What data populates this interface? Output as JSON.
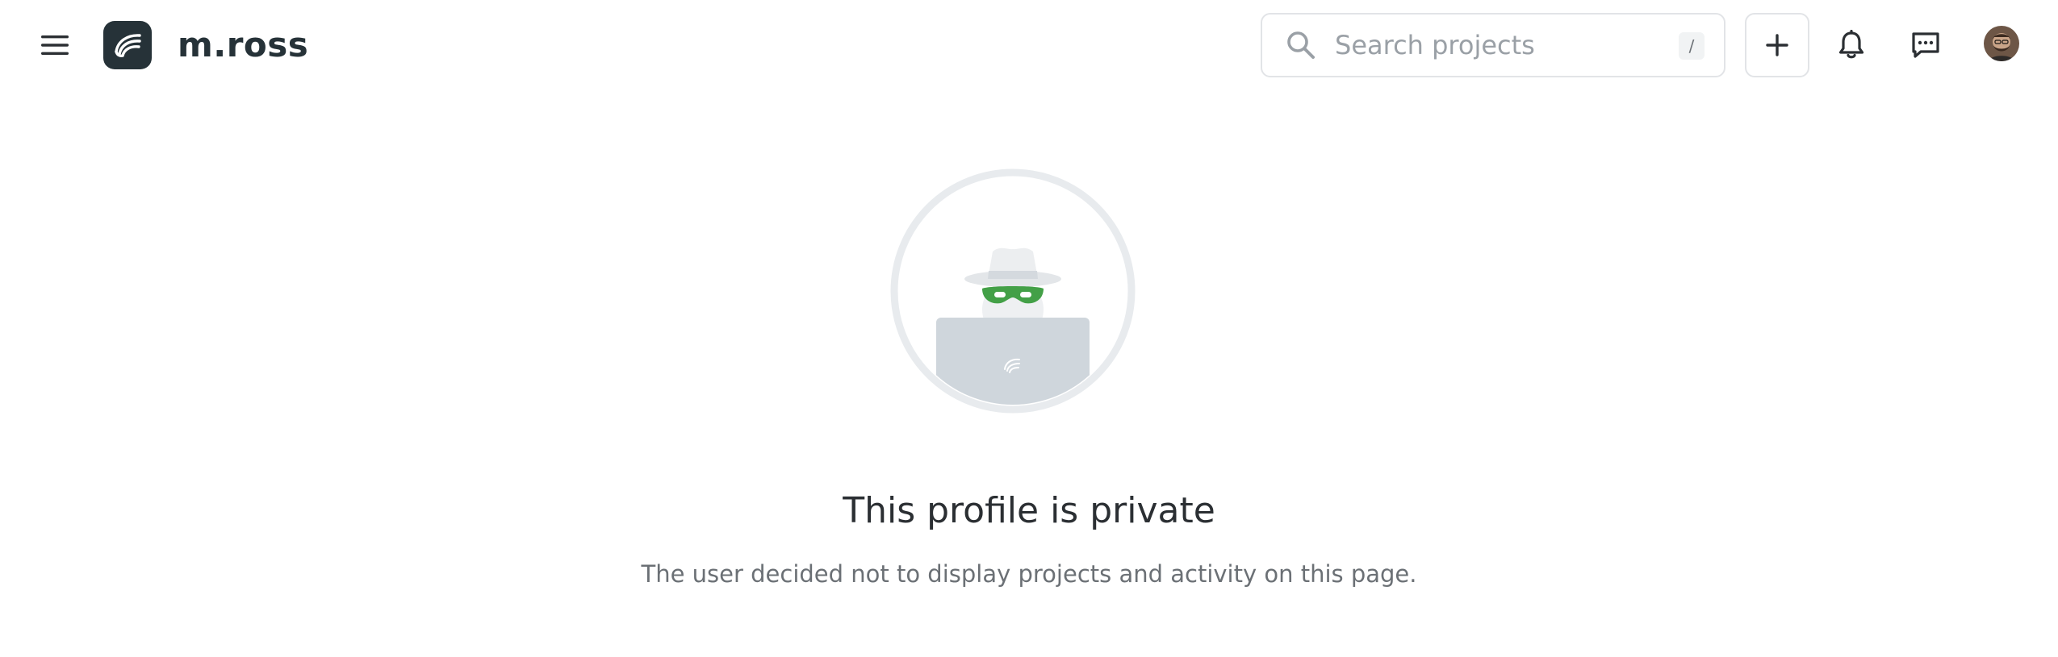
{
  "header": {
    "menu_icon": "hamburger-menu-icon",
    "logo_icon": "brand-logo-icon",
    "username": "m.ross",
    "search": {
      "placeholder": "Search projects",
      "value": "",
      "shortcut": "/",
      "icon": "search-icon"
    },
    "add_icon": "plus-icon",
    "notifications_icon": "bell-icon",
    "messages_icon": "chat-icon",
    "avatar_icon": "user-avatar"
  },
  "main": {
    "illustration_icon": "private-profile-spy-illustration",
    "title": "This profile is private",
    "subtitle": "The user decided not to display projects and activity on this page."
  },
  "colors": {
    "logo_bg": "#263238",
    "illustration_ring": "#e8ebee",
    "illustration_laptop": "#cfd6dc",
    "mask_green": "#43a047",
    "text_primary": "#2b2f33",
    "text_secondary": "#6b7075",
    "border": "#e2e4e7"
  }
}
